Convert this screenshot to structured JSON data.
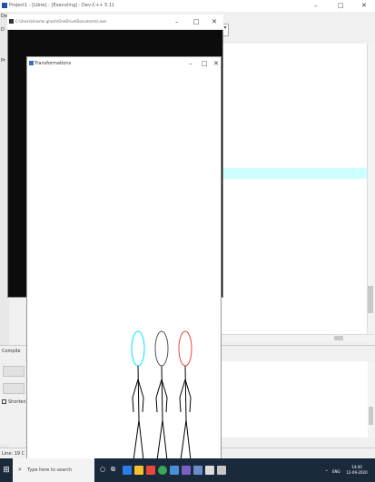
{
  "main_window": {
    "title": "Project1 - [Libre] - [Executing] - Dev-C++ 5.11",
    "minimize": "–",
    "maximize": "□",
    "close": "✕"
  },
  "left_strip": {
    "chars": [
      "De",
      "D",
      "Pr"
    ]
  },
  "bottom_pane": {
    "tab_compile": "Compile",
    "shorten_label": "Shorten compile"
  },
  "statusbar": {
    "text": "Line: 19   C"
  },
  "console_window": {
    "title": "C:\\Users\\shivmo ghosh\\OneDrive\\Documents\\.exe",
    "minimize": "–",
    "maximize": "□",
    "close": "✕"
  },
  "graphics_window": {
    "title": "Transformations",
    "minimize": "–",
    "maximize": "□",
    "close": "✕"
  },
  "stick_figures": [
    {
      "color": "#00e5ff"
    },
    {
      "color": "#555555"
    },
    {
      "color": "#e8483b"
    }
  ],
  "taskbar": {
    "search_placeholder": "Type here to search",
    "tray_text": "ENG",
    "time": "14:40",
    "date": "12-09-2020"
  }
}
